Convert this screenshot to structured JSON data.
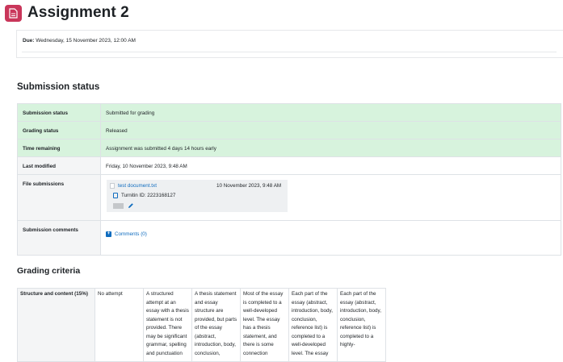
{
  "header": {
    "title": "Assignment 2",
    "icon": "assignment-icon",
    "icon_color": "#c9365a"
  },
  "dates": {
    "due_label": "Due:",
    "due_value": "Wednesday, 15 November 2023, 12:00 AM"
  },
  "submission_status": {
    "heading": "Submission status",
    "rows": [
      {
        "label": "Submission status",
        "value": "Submitted for grading"
      },
      {
        "label": "Grading status",
        "value": "Released"
      },
      {
        "label": "Time remaining",
        "value": "Assignment was submitted 4 days 14 hours early"
      },
      {
        "label": "Last modified",
        "value": "Friday, 10 November 2023, 9:48 AM"
      },
      {
        "label": "File submissions"
      },
      {
        "label": "Submission comments"
      }
    ],
    "file": {
      "name": "test document.txt",
      "date": "10 November 2023, 9:48 AM",
      "turnitin_id": "Turnitin ID: 2223168127"
    },
    "comments_link": "Comments (0)",
    "highlight_color": "#d7f3dd"
  },
  "grading": {
    "heading": "Grading criteria",
    "criterion": "Structure and content (15%)",
    "levels": [
      "No attempt",
      "A structured attempt at an essay with a thesis statement is not provided. There may be significant grammar, spelling and punctuation",
      "A thesis statement and essay structure are provided, but parts of the essay (abstract, introduction, body, conclusion,",
      "Most of the essay is completed to a well-developed level. The essay has a thesis statement, and there is some connection",
      "Each part of the essay (abstract, introduction, body, conclusion, reference list) is completed to a well-developed level. The essay",
      "Each part of the essay (abstract, introduction, body, conclusion, reference list) is completed to a highly-"
    ]
  }
}
